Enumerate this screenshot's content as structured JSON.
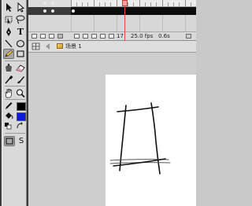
{
  "window": {
    "app": "Flash authoring window",
    "accent_playhead": "#e24a4a",
    "frame_row_color": "#0c0c0c",
    "stage_color": "#ffffff"
  },
  "toolbox": {
    "tools": [
      {
        "name": "selection-tool",
        "glyph": "↖"
      },
      {
        "name": "subselection-tool",
        "glyph": "↖"
      },
      {
        "name": "free-transform-tool",
        "glyph": "⊡"
      },
      {
        "name": "lasso-tool",
        "glyph": "ρ"
      },
      {
        "name": "pen-tool",
        "glyph": "✒"
      },
      {
        "name": "text-tool",
        "glyph": "T"
      },
      {
        "name": "line-tool",
        "glyph": "╲"
      },
      {
        "name": "oval-tool",
        "glyph": "○"
      },
      {
        "name": "rectangle-tool",
        "glyph": "□"
      },
      {
        "name": "pencil-tool",
        "glyph": "✎"
      },
      {
        "name": "brush-tool",
        "glyph": "✐"
      },
      {
        "name": "ink-bottle-tool",
        "glyph": "⚱"
      },
      {
        "name": "paint-bucket-tool",
        "glyph": "◈"
      },
      {
        "name": "eyedropper-tool",
        "glyph": "⊿"
      },
      {
        "name": "eraser-tool",
        "glyph": "▱"
      },
      {
        "name": "hand-tool",
        "glyph": "✋"
      },
      {
        "name": "zoom-tool",
        "glyph": "⌕"
      }
    ],
    "stroke_color": "#000000",
    "fill_color": "#0b1bdc",
    "snap_label": "S"
  },
  "timeline": {
    "current_frame": "17",
    "frame_rate": "25.0 fps",
    "elapsed_time": "0.6s"
  },
  "editbar": {
    "scene_name": "场景 1"
  }
}
